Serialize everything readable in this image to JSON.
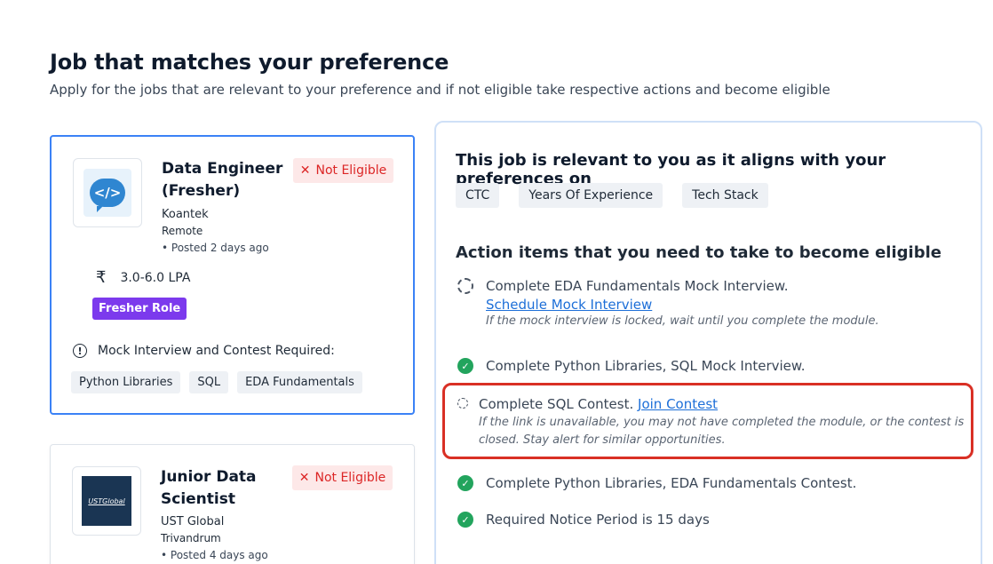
{
  "header": {
    "title": "Job that matches your preference",
    "subtitle": "Apply for the jobs that are relevant to your preference and if not eligible take respective actions and become eligible"
  },
  "jobs": [
    {
      "title": "Data Engineer (Fresher)",
      "company": "Koantek",
      "location": "Remote",
      "posted": "• Posted 2 days ago",
      "status": "Not Eligible",
      "salary": "3.0-6.0 LPA",
      "role_tag": "Fresher Role",
      "requirement": "Mock Interview and Contest Required:",
      "skills": [
        "Python Libraries",
        "SQL",
        "EDA Fundamentals"
      ],
      "logo_text": "</>"
    },
    {
      "title": "Junior Data Scientist",
      "company": "UST Global",
      "location": "Trivandrum",
      "posted": "• Posted 4 days ago",
      "status": "Not Eligible",
      "logo_text": "USTGlobal"
    }
  ],
  "details": {
    "relevance_heading": "This job is relevant to you as it aligns with your preferences on",
    "preferences": [
      "CTC",
      "Years Of Experience",
      "Tech Stack"
    ],
    "actions_heading": "Action items that you need to take to become eligible",
    "actions": [
      {
        "state": "pending",
        "text": "Complete EDA Fundamentals Mock Interview.",
        "link": "Schedule Mock Interview",
        "note": "If the mock interview is locked, wait until you complete the module."
      },
      {
        "state": "done",
        "text": "Complete Python Libraries, SQL Mock Interview."
      },
      {
        "state": "pending",
        "text": "Complete SQL Contest.",
        "link": "Join Contest",
        "note": "If the link is unavailable, you may not have completed the module, or the contest is closed. Stay alert for similar opportunities."
      },
      {
        "state": "done",
        "text": "Complete Python Libraries, EDA Fundamentals Contest."
      },
      {
        "state": "done",
        "text": "Required Notice Period is 15 days"
      }
    ]
  },
  "icons": {
    "close": "close-icon",
    "rupee": "₹",
    "info": "!",
    "check": "✓"
  },
  "colors": {
    "accent_blue": "#3b82f6",
    "not_eligible_red": "#dc2626",
    "fresher_purple": "#7c3aed",
    "success_green": "#22a45d",
    "link_blue": "#1d6fd8",
    "highlight_red": "#d93025"
  }
}
